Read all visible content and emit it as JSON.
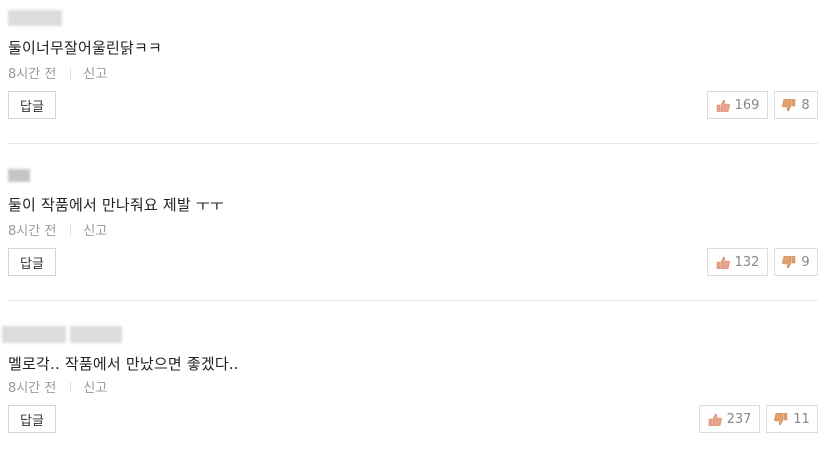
{
  "comments": [
    {
      "text": "둘이너무잘어울린닭ㅋㅋ",
      "time": "8시간 전",
      "report": "신고",
      "reply_label": "답글",
      "likes": "169",
      "dislikes": "8"
    },
    {
      "text": "둘이 작품에서 만나줘요 제발 ㅜㅜ",
      "time": "8시간 전",
      "report": "신고",
      "reply_label": "답글",
      "likes": "132",
      "dislikes": "9"
    },
    {
      "text": "멜로각.. 작품에서 만났으면 좋겠다..",
      "time": "8시간 전",
      "report": "신고",
      "reply_label": "답글",
      "likes": "237",
      "dislikes": "11"
    }
  ],
  "icons": {
    "like": "thumbs-up-icon",
    "dislike": "thumbs-down-icon"
  },
  "colors": {
    "like_icon": "#e8a48a",
    "dislike_icon": "#e0a070",
    "meta_text": "#999999",
    "divider": "#e6e6e6"
  }
}
